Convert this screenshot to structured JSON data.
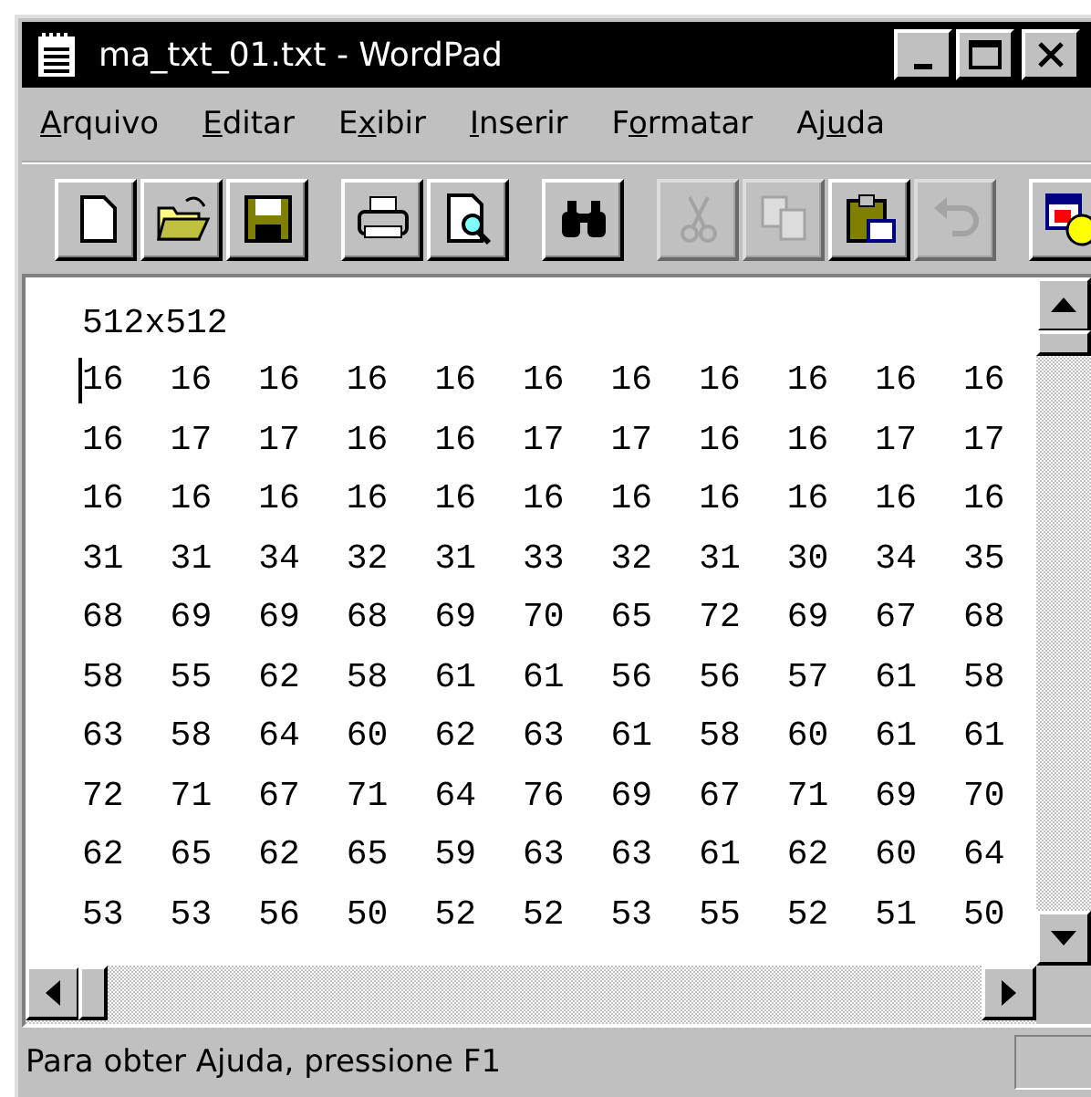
{
  "window": {
    "title": "ma_txt_01.txt - WordPad"
  },
  "menu": [
    {
      "key": "A",
      "after": "rquivo"
    },
    {
      "key": "E",
      "after": "ditar"
    },
    {
      "before": "E",
      "key": "x",
      "after": "ibir"
    },
    {
      "key": "I",
      "after": "nserir"
    },
    {
      "before": "F",
      "key": "o",
      "after": "rmatar"
    },
    {
      "before": "Aj",
      "key": "u",
      "after": "da"
    }
  ],
  "toolbar": [
    [
      {
        "kind": "new",
        "disabled": false
      },
      {
        "kind": "open",
        "disabled": false
      },
      {
        "kind": "save",
        "disabled": false
      }
    ],
    [
      {
        "kind": "print",
        "disabled": false
      },
      {
        "kind": "preview",
        "disabled": false
      }
    ],
    [
      {
        "kind": "find",
        "disabled": false
      }
    ],
    [
      {
        "kind": "cut",
        "disabled": true
      },
      {
        "kind": "copy",
        "disabled": true
      },
      {
        "kind": "paste",
        "disabled": false
      },
      {
        "kind": "undo",
        "disabled": true
      }
    ],
    [
      {
        "kind": "datetime",
        "disabled": false
      }
    ]
  ],
  "document": {
    "header": "512x512",
    "rows": [
      [
        "16",
        "16",
        "16",
        "16",
        "16",
        "16",
        "16",
        "16",
        "16",
        "16",
        "16"
      ],
      [
        "16",
        "17",
        "17",
        "16",
        "16",
        "17",
        "17",
        "16",
        "16",
        "17",
        "17"
      ],
      [
        "16",
        "16",
        "16",
        "16",
        "16",
        "16",
        "16",
        "16",
        "16",
        "16",
        "16"
      ],
      [
        "31",
        "31",
        "34",
        "32",
        "31",
        "33",
        "32",
        "31",
        "30",
        "34",
        "35"
      ],
      [
        "68",
        "69",
        "69",
        "68",
        "69",
        "70",
        "65",
        "72",
        "69",
        "67",
        "68"
      ],
      [
        "58",
        "55",
        "62",
        "58",
        "61",
        "61",
        "56",
        "56",
        "57",
        "61",
        "58"
      ],
      [
        "63",
        "58",
        "64",
        "60",
        "62",
        "63",
        "61",
        "58",
        "60",
        "61",
        "61"
      ],
      [
        "72",
        "71",
        "67",
        "71",
        "64",
        "76",
        "69",
        "67",
        "71",
        "69",
        "70"
      ],
      [
        "62",
        "65",
        "62",
        "65",
        "59",
        "63",
        "63",
        "61",
        "62",
        "60",
        "64"
      ],
      [
        "53",
        "53",
        "56",
        "50",
        "52",
        "52",
        "53",
        "55",
        "52",
        "51",
        "50"
      ]
    ]
  },
  "status_bar": {
    "text": "Para obter Ajuda, pressione F1"
  }
}
